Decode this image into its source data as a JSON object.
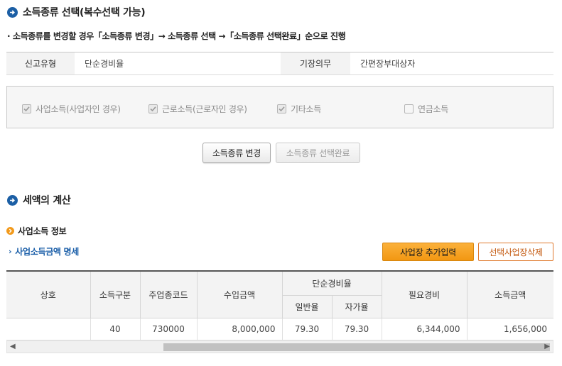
{
  "section1": {
    "title": "소득종류 선택(복수선택 가능)"
  },
  "guide": "· 소득종류를 변경할 경우「소득종류 변경」→ 소득종류 선택 →「소득종류 선택완료」순으로 진행",
  "info": {
    "report_type_label": "신고유형",
    "report_type_value": "단순경비율",
    "bookkeeping_label": "기장의무",
    "bookkeeping_value": "간편장부대상자"
  },
  "income_types": [
    {
      "label": "사업소득(사업자인 경우)",
      "checked": true
    },
    {
      "label": "근로소득(근로자인 경우)",
      "checked": true
    },
    {
      "label": "기타소득",
      "checked": true
    },
    {
      "label": "연금소득",
      "checked": false
    }
  ],
  "buttons": {
    "change": "소득종류 변경",
    "complete": "소득종류 선택완료",
    "add_business": "사업장 추가입력",
    "delete_business": "선택사업장삭제"
  },
  "section2": {
    "title": "세액의 계산"
  },
  "business_info": {
    "title": "사업소득 정보"
  },
  "link": {
    "label": "사업소득금액 명세"
  },
  "table": {
    "headers": {
      "name": "상호",
      "income_class": "소득구분",
      "industry_code": "주업종코드",
      "revenue": "수입금액",
      "simple_rate": "단순경비율",
      "general_rate": "일반율",
      "self_rate": "자가율",
      "expense": "필요경비",
      "income": "소득금액"
    },
    "rows": [
      {
        "name": "",
        "income_class": "40",
        "industry_code": "730000",
        "revenue": "8,000,000",
        "general_rate": "79.30",
        "self_rate": "79.30",
        "expense": "6,344,000",
        "income": "1,656,000"
      }
    ]
  },
  "colors": {
    "section_icon": "#1c5fa5",
    "sub_icon": "#f29a1c",
    "link": "#1a5ea8",
    "primary_button": "#f29712",
    "outline_button": "#e07a2f"
  }
}
